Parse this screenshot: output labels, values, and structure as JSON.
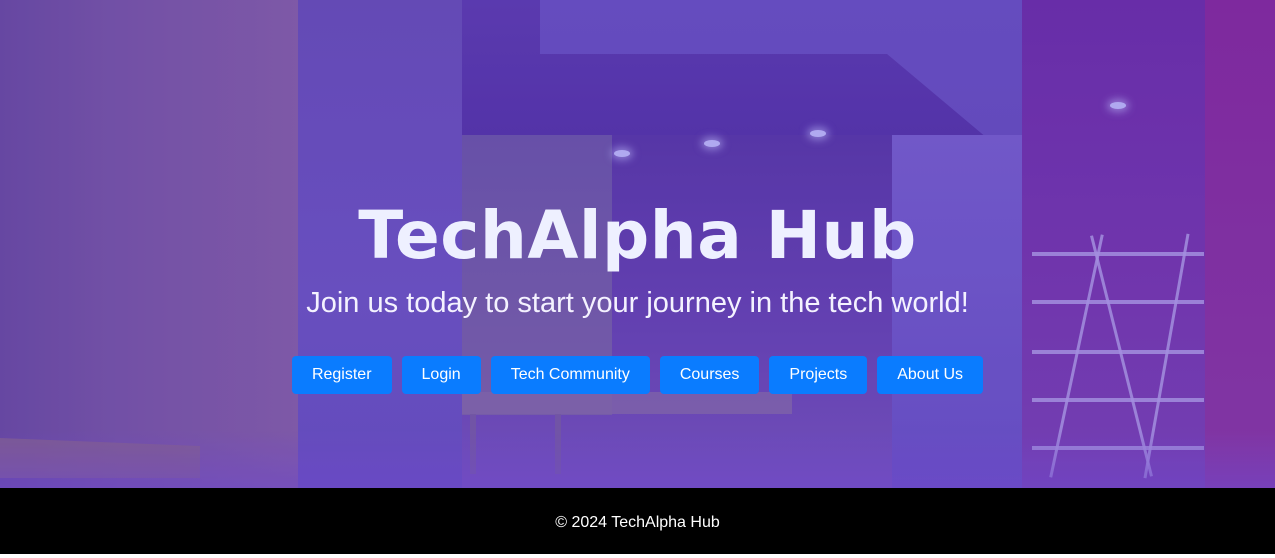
{
  "hero": {
    "title": "TechAlpha Hub",
    "subtitle": "Join us today to start your journey in the tech world!",
    "background": "interior-room-photo",
    "overlay_color": "#4628aa"
  },
  "nav_buttons": [
    {
      "label": "Register"
    },
    {
      "label": "Login"
    },
    {
      "label": "Tech Community"
    },
    {
      "label": "Courses"
    },
    {
      "label": "Projects"
    },
    {
      "label": "About Us"
    }
  ],
  "colors": {
    "button_bg": "#0a7cff",
    "button_text": "#ffffff",
    "footer_bg": "#000000"
  },
  "footer": {
    "copyright": "© 2024 TechAlpha Hub"
  }
}
